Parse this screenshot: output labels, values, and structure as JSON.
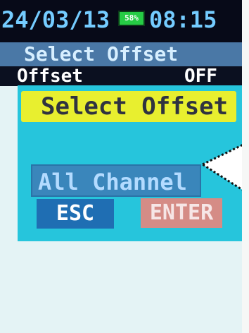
{
  "status": {
    "date": "24/03/13",
    "battery": "58%",
    "time": "08:15"
  },
  "header": {
    "title": "Select Offset"
  },
  "setting": {
    "label": "Offset",
    "value": "OFF"
  },
  "dialog": {
    "title": "Select Offset",
    "selection": "All Channel",
    "buttons": {
      "esc": "ESC",
      "enter": "ENTER"
    }
  },
  "colors": {
    "accent": "#26c5dc",
    "highlight": "#e8ef2f",
    "battery": "#26cc45"
  }
}
